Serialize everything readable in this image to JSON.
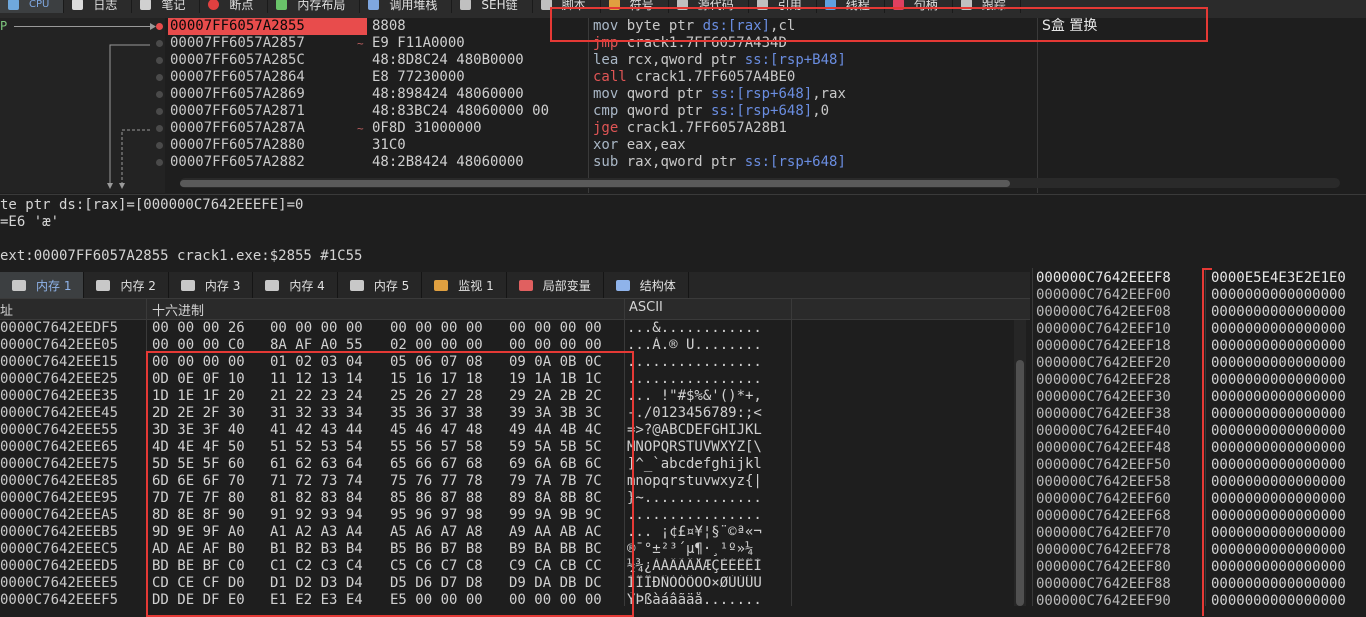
{
  "top_tabs": [
    {
      "label": "CPU",
      "icon": "cpu-icon",
      "active": true
    },
    {
      "label": "日志",
      "icon": "log-icon"
    },
    {
      "label": "笔记",
      "icon": "notes-icon"
    },
    {
      "label": "断点",
      "icon": "breakpoint-icon"
    },
    {
      "label": "内存布局",
      "icon": "memory-map-icon"
    },
    {
      "label": "调用堆栈",
      "icon": "call-stack-icon"
    },
    {
      "label": "SEH链",
      "icon": "seh-icon"
    },
    {
      "label": "脚本",
      "icon": "script-icon"
    },
    {
      "label": "符号",
      "icon": "symbols-icon"
    },
    {
      "label": "源代码",
      "icon": "source-icon"
    },
    {
      "label": "引用",
      "icon": "references-icon"
    },
    {
      "label": "线程",
      "icon": "threads-icon"
    },
    {
      "label": "句柄",
      "icon": "handles-icon"
    },
    {
      "label": "跟踪",
      "icon": "trace-icon"
    }
  ],
  "disasm": {
    "ip_label": "P",
    "rows": [
      {
        "addr": "00007FF6057A2855",
        "jm": "",
        "bytes": "8808",
        "mn": "mov",
        "ops": [
          [
            "op",
            "byte ptr "
          ],
          [
            "kw",
            "ds:[rax]"
          ],
          [
            "op",
            ",cl"
          ]
        ],
        "comment": "S盒 置换",
        "current": true
      },
      {
        "addr": "00007FF6057A2857",
        "jm": "~",
        "bytes": "E9 F11A0000",
        "mn": "jmp",
        "ops": [
          [
            "op",
            "crack1.7FF6057A434D"
          ]
        ],
        "comment": ""
      },
      {
        "addr": "00007FF6057A285C",
        "jm": "",
        "bytes": "48:8D8C24 480B0000",
        "mn": "lea",
        "ops": [
          [
            "op",
            "rcx,qword ptr "
          ],
          [
            "kw",
            "ss:[rsp+B48]"
          ]
        ],
        "comment": ""
      },
      {
        "addr": "00007FF6057A2864",
        "jm": "",
        "bytes": "E8 77230000",
        "mn": "call",
        "ops": [
          [
            "op",
            "crack1.7FF6057A4BE0"
          ]
        ],
        "comment": ""
      },
      {
        "addr": "00007FF6057A2869",
        "jm": "",
        "bytes": "48:898424 48060000",
        "mn": "mov",
        "ops": [
          [
            "op",
            "qword ptr "
          ],
          [
            "kw",
            "ss:[rsp+648]"
          ],
          [
            "op",
            ",rax"
          ]
        ],
        "comment": ""
      },
      {
        "addr": "00007FF6057A2871",
        "jm": "",
        "bytes": "48:83BC24 48060000 00",
        "mn": "cmp",
        "ops": [
          [
            "op",
            "qword ptr "
          ],
          [
            "kw",
            "ss:[rsp+648]"
          ],
          [
            "op",
            ",0"
          ]
        ],
        "comment": ""
      },
      {
        "addr": "00007FF6057A287A",
        "jm": "~",
        "bytes": "0F8D 31000000",
        "mn": "jge",
        "ops": [
          [
            "op",
            "crack1.7FF6057A28B1"
          ]
        ],
        "comment": ""
      },
      {
        "addr": "00007FF6057A2880",
        "jm": "",
        "bytes": "31C0",
        "mn": "xor",
        "ops": [
          [
            "op",
            "eax,eax"
          ]
        ],
        "comment": ""
      },
      {
        "addr": "00007FF6057A2882",
        "jm": "",
        "bytes": "48:2B8424 48060000",
        "mn": "sub",
        "ops": [
          [
            "op",
            "rax,qword ptr "
          ],
          [
            "kw",
            "ss:[rsp+648]"
          ]
        ],
        "comment": ""
      }
    ]
  },
  "info": {
    "line1": "te ptr ds:[rax]=[000000C7642EEEFE]=0",
    "line2": "=E6 'æ'",
    "line3": "ext:00007FF6057A2855 crack1.exe:$2855 #1C55"
  },
  "mem_tabs": [
    {
      "label": "内存 1",
      "icon": "dump-icon",
      "active": true
    },
    {
      "label": "内存 2",
      "icon": "dump-icon"
    },
    {
      "label": "内存 3",
      "icon": "dump-icon"
    },
    {
      "label": "内存 4",
      "icon": "dump-icon"
    },
    {
      "label": "内存 5",
      "icon": "dump-icon"
    },
    {
      "label": "监视 1",
      "icon": "watch-icon"
    },
    {
      "label": "局部变量",
      "icon": "locals-icon"
    },
    {
      "label": "结构体",
      "icon": "struct-icon"
    }
  ],
  "dump": {
    "headers": {
      "addr": "址",
      "hex": "十六进制",
      "ascii": "ASCII"
    },
    "rows": [
      {
        "addr": "0000C7642EEDF5",
        "hex": [
          "00 00 00 26",
          "00 00 00 00",
          "00 00 00 00",
          "00 00 00 00"
        ],
        "ascii": "...&............"
      },
      {
        "addr": "0000C7642EEE05",
        "hex": [
          "00 00 00 C0",
          "8A AF A0 55",
          "02 00 00 00",
          "00 00 00 00"
        ],
        "ascii": "...À.® U........"
      },
      {
        "addr": "0000C7642EEE15",
        "hex": [
          "00 00 00 00",
          "01 02 03 04",
          "05 06 07 08",
          "09 0A 0B 0C"
        ],
        "ascii": "................"
      },
      {
        "addr": "0000C7642EEE25",
        "hex": [
          "0D 0E 0F 10",
          "11 12 13 14",
          "15 16 17 18",
          "19 1A 1B 1C"
        ],
        "ascii": "................"
      },
      {
        "addr": "0000C7642EEE35",
        "hex": [
          "1D 1E 1F 20",
          "21 22 23 24",
          "25 26 27 28",
          "29 2A 2B 2C"
        ],
        "ascii": "... !\"#$%&'()*+,"
      },
      {
        "addr": "0000C7642EEE45",
        "hex": [
          "2D 2E 2F 30",
          "31 32 33 34",
          "35 36 37 38",
          "39 3A 3B 3C"
        ],
        "ascii": "-./0123456789:;<"
      },
      {
        "addr": "0000C7642EEE55",
        "hex": [
          "3D 3E 3F 40",
          "41 42 43 44",
          "45 46 47 48",
          "49 4A 4B 4C"
        ],
        "ascii": "=>?@ABCDEFGHIJKL"
      },
      {
        "addr": "0000C7642EEE65",
        "hex": [
          "4D 4E 4F 50",
          "51 52 53 54",
          "55 56 57 58",
          "59 5A 5B 5C"
        ],
        "ascii": "MNOPQRSTUVWXYZ[\\"
      },
      {
        "addr": "0000C7642EEE75",
        "hex": [
          "5D 5E 5F 60",
          "61 62 63 64",
          "65 66 67 68",
          "69 6A 6B 6C"
        ],
        "ascii": "]^_`abcdefghijkl"
      },
      {
        "addr": "0000C7642EEE85",
        "hex": [
          "6D 6E 6F 70",
          "71 72 73 74",
          "75 76 77 78",
          "79 7A 7B 7C"
        ],
        "ascii": "mnopqrstuvwxyz{|"
      },
      {
        "addr": "0000C7642EEE95",
        "hex": [
          "7D 7E 7F 80",
          "81 82 83 84",
          "85 86 87 88",
          "89 8A 8B 8C"
        ],
        "ascii": "}~.............."
      },
      {
        "addr": "0000C7642EEEA5",
        "hex": [
          "8D 8E 8F 90",
          "91 92 93 94",
          "95 96 97 98",
          "99 9A 9B 9C"
        ],
        "ascii": "................"
      },
      {
        "addr": "0000C7642EEEB5",
        "hex": [
          "9D 9E 9F A0",
          "A1 A2 A3 A4",
          "A5 A6 A7 A8",
          "A9 AA AB AC"
        ],
        "ascii": "... ¡¢£¤¥¦§¨©ª«¬"
      },
      {
        "addr": "0000C7642EEEC5",
        "hex": [
          "AD AE AF B0",
          "B1 B2 B3 B4",
          "B5 B6 B7 B8",
          "B9 BA BB BC"
        ],
        "ascii": "®¯°±²³´µ¶·¸¹º»¼"
      },
      {
        "addr": "0000C7642EEED5",
        "hex": [
          "BD BE BF C0",
          "C1 C2 C3 C4",
          "C5 C6 C7 C8",
          "C9 CA CB CC"
        ],
        "ascii": "½¾¿ÀÁÂÃÄÅÆÇÈÉÊËÌ"
      },
      {
        "addr": "0000C7642EEEE5",
        "hex": [
          "CD CE CF D0",
          "D1 D2 D3 D4",
          "D5 D6 D7 D8",
          "D9 DA DB DC"
        ],
        "ascii": "ÍÎÏÐÑÒÓÔÕÖ×ØÙÚÛÜ"
      },
      {
        "addr": "0000C7642EEEF5",
        "hex": [
          "DD DE DF E0",
          "E1 E2 E3 E4",
          "E5 00 00 00",
          "00 00 00 00"
        ],
        "ascii": "ÝÞßàáâãäå......."
      }
    ]
  },
  "stack": {
    "rows": [
      {
        "addr": "000000C7642EEEF8",
        "val": "0000E5E4E3E2E1E0",
        "top": true
      },
      {
        "addr": "000000C7642EEF00",
        "val": "0000000000000000"
      },
      {
        "addr": "000000C7642EEF08",
        "val": "0000000000000000"
      },
      {
        "addr": "000000C7642EEF10",
        "val": "0000000000000000"
      },
      {
        "addr": "000000C7642EEF18",
        "val": "0000000000000000"
      },
      {
        "addr": "000000C7642EEF20",
        "val": "0000000000000000"
      },
      {
        "addr": "000000C7642EEF28",
        "val": "0000000000000000"
      },
      {
        "addr": "000000C7642EEF30",
        "val": "0000000000000000"
      },
      {
        "addr": "000000C7642EEF38",
        "val": "0000000000000000"
      },
      {
        "addr": "000000C7642EEF40",
        "val": "0000000000000000"
      },
      {
        "addr": "000000C7642EEF48",
        "val": "0000000000000000"
      },
      {
        "addr": "000000C7642EEF50",
        "val": "0000000000000000"
      },
      {
        "addr": "000000C7642EEF58",
        "val": "0000000000000000"
      },
      {
        "addr": "000000C7642EEF60",
        "val": "0000000000000000"
      },
      {
        "addr": "000000C7642EEF68",
        "val": "0000000000000000"
      },
      {
        "addr": "000000C7642EEF70",
        "val": "0000000000000000"
      },
      {
        "addr": "000000C7642EEF78",
        "val": "0000000000000000"
      },
      {
        "addr": "000000C7642EEF80",
        "val": "0000000000000000"
      },
      {
        "addr": "000000C7642EEF88",
        "val": "0000000000000000"
      },
      {
        "addr": "000000C7642EEF90",
        "val": "0000000000000000"
      }
    ]
  },
  "colors": {
    "current_line": "#e84c4c",
    "annotation": "#e53935",
    "accent": "#8fb3ea"
  }
}
